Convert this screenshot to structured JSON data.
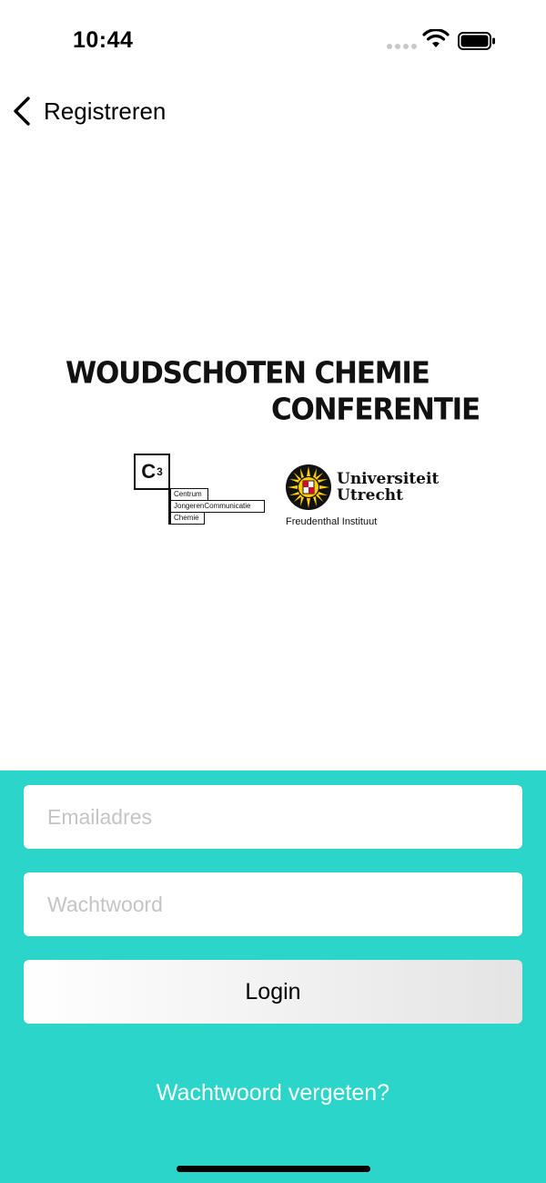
{
  "status_bar": {
    "time": "10:44"
  },
  "nav": {
    "back_label": "Registreren"
  },
  "logo": {
    "title_line1": "WOUDSCHOTEN CHEMIE",
    "title_line2": "CONFERENTIE",
    "c3_mark": "C",
    "c3_superscript": "3",
    "c3_row1": "Centrum",
    "c3_row2": "JongerenCommunicatie",
    "c3_row3": "Chemie",
    "uu_line1": "Universiteit",
    "uu_line2": "Utrecht",
    "uu_sub": "Freudenthal Instituut"
  },
  "form": {
    "email_placeholder": "Emailadres",
    "email_value": "",
    "password_placeholder": "Wachtwoord",
    "password_value": "",
    "login_label": "Login",
    "forgot_label": "Wachtwoord vergeten?"
  },
  "colors": {
    "panel_bg": "#2bd5c9",
    "field_bg": "#ffffff",
    "placeholder": "#c4c4c8"
  },
  "icons": [
    "wifi-icon",
    "battery-icon",
    "chevron-left-icon",
    "university-seal-icon"
  ]
}
